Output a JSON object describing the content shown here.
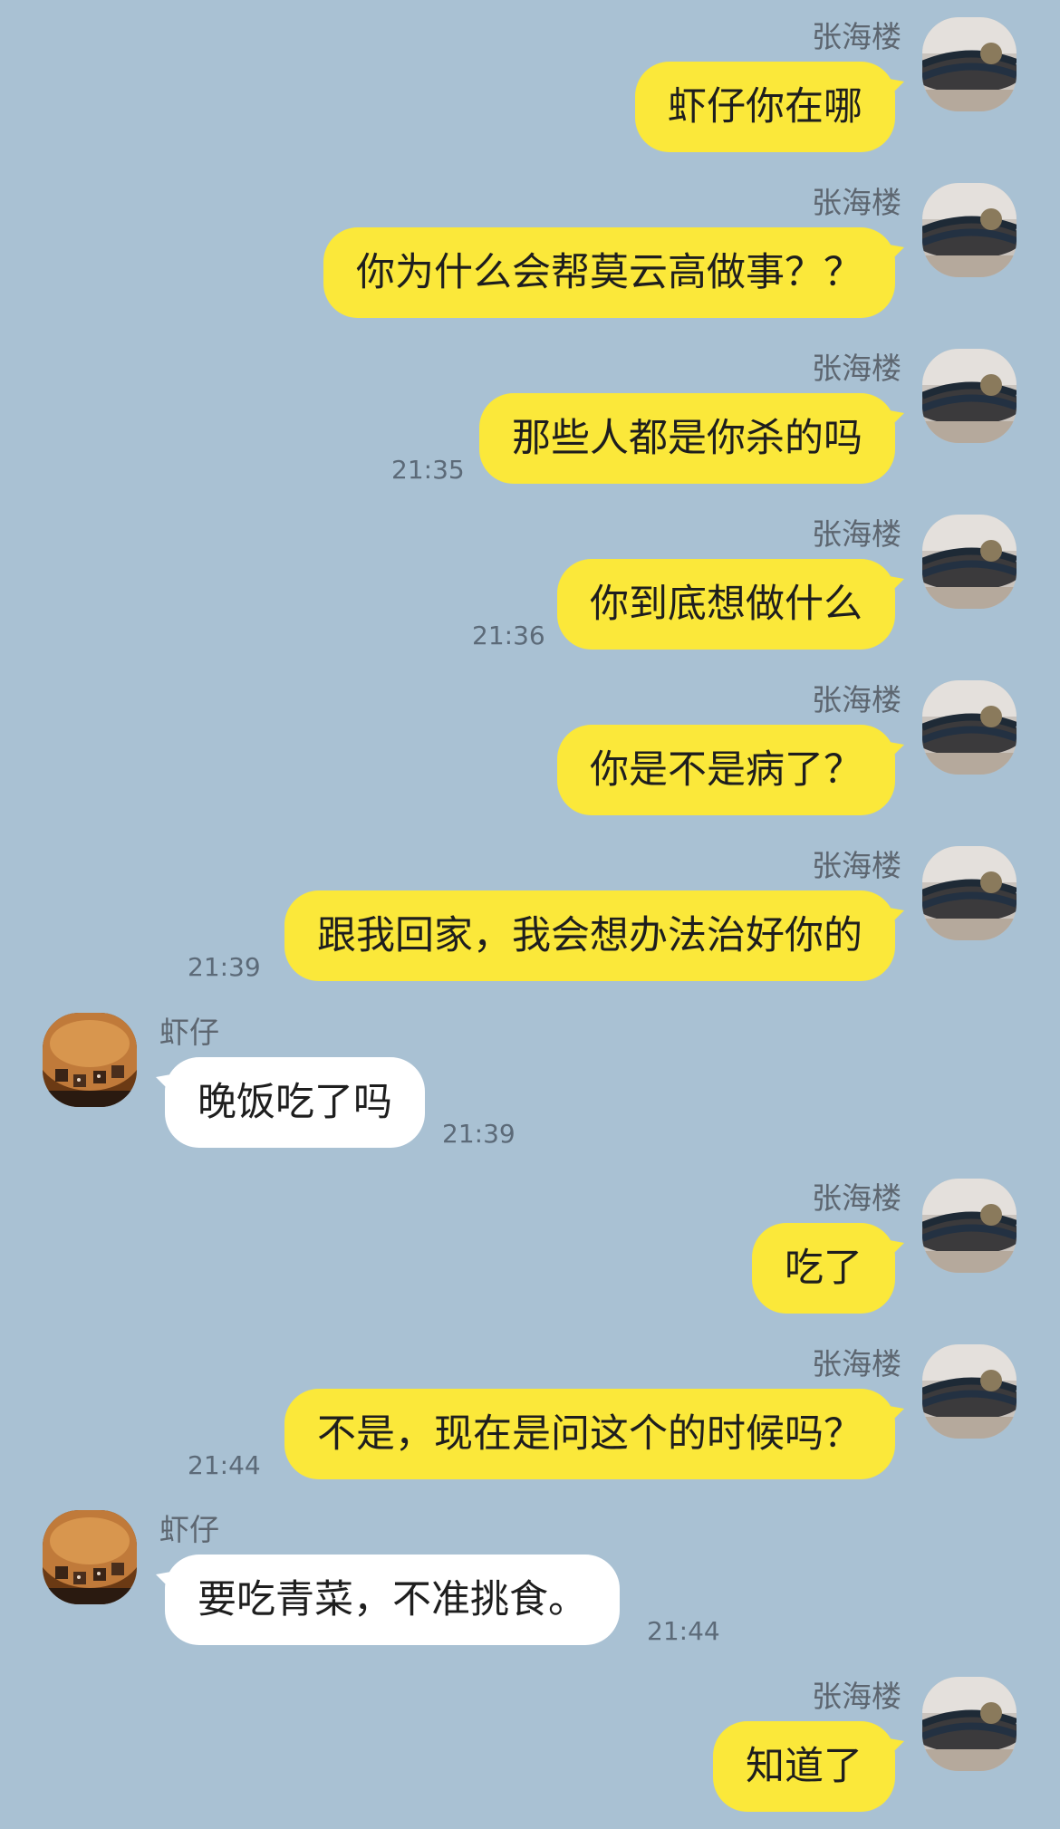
{
  "colors": {
    "background": "#a9c1d3",
    "outgoing_bubble": "#fbe83a",
    "incoming_bubble": "#ffffff"
  },
  "messages": [
    {
      "side": "right",
      "sender": "张海楼",
      "text": "虾仔你在哪",
      "time": ""
    },
    {
      "side": "right",
      "sender": "张海楼",
      "text": "你为什么会帮莫云高做事？？",
      "time": ""
    },
    {
      "side": "right",
      "sender": "张海楼",
      "text": "那些人都是你杀的吗",
      "time": "21:35"
    },
    {
      "side": "right",
      "sender": "张海楼",
      "text": "你到底想做什么",
      "time": "21:36"
    },
    {
      "side": "right",
      "sender": "张海楼",
      "text": "你是不是病了？",
      "time": ""
    },
    {
      "side": "right",
      "sender": "张海楼",
      "text": "跟我回家，我会想办法治好你的",
      "time": "21:39"
    },
    {
      "side": "left",
      "sender": "虾仔",
      "text": "晚饭吃了吗",
      "time": "21:39"
    },
    {
      "side": "right",
      "sender": "张海楼",
      "text": "吃了",
      "time": ""
    },
    {
      "side": "right",
      "sender": "张海楼",
      "text": "不是，现在是问这个的时候吗？",
      "time": "21:44"
    },
    {
      "side": "left",
      "sender": "虾仔",
      "text": "要吃青菜，不准挑食。",
      "time": "21:44"
    },
    {
      "side": "right",
      "sender": "张海楼",
      "text": "知道了",
      "time": ""
    }
  ]
}
